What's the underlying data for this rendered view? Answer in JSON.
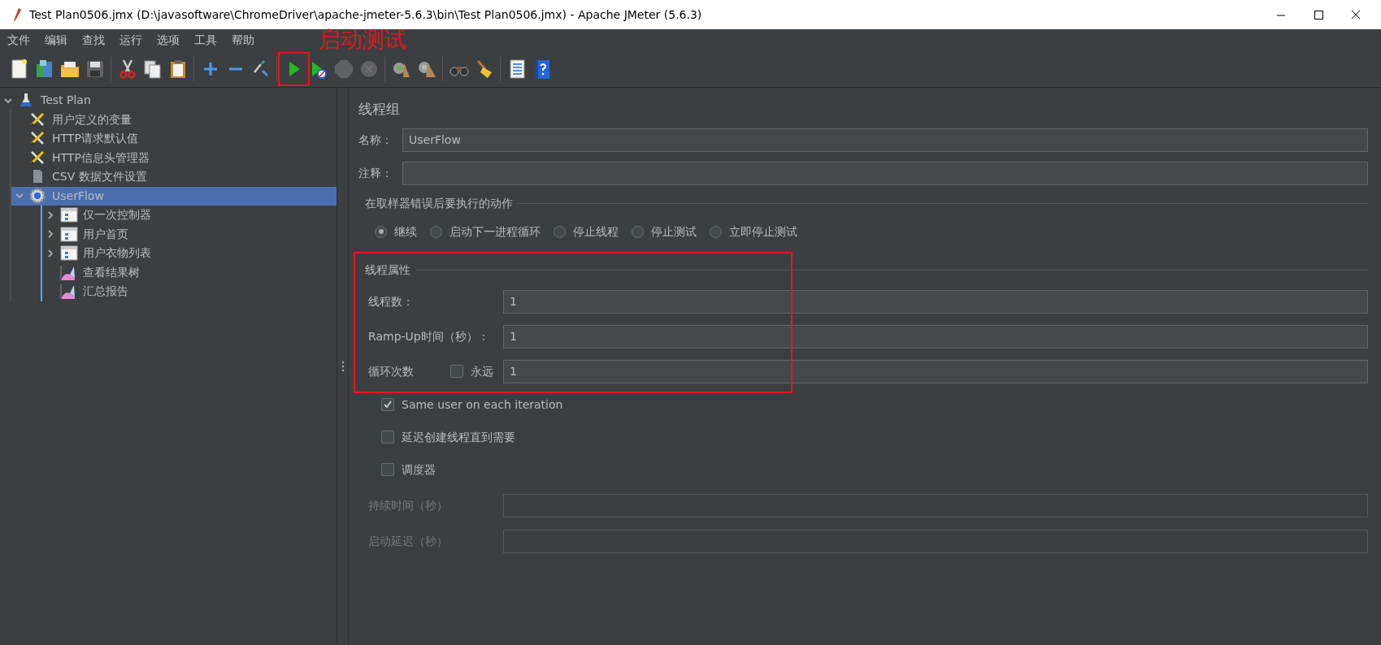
{
  "window": {
    "title": "Test Plan0506.jmx (D:\\javasoftware\\ChromeDriver\\apache-jmeter-5.6.3\\bin\\Test Plan0506.jmx) - Apache JMeter (5.6.3)"
  },
  "menu": [
    "文件",
    "编辑",
    "查找",
    "运行",
    "选项",
    "工具",
    "帮助"
  ],
  "annotation": {
    "text": "启动测试"
  },
  "toolbar": [
    {
      "kind": "new"
    },
    {
      "kind": "templates"
    },
    {
      "kind": "open"
    },
    {
      "kind": "save"
    },
    {
      "kind": "separator"
    },
    {
      "kind": "cut"
    },
    {
      "kind": "copy"
    },
    {
      "kind": "paste"
    },
    {
      "kind": "separator"
    },
    {
      "kind": "expand"
    },
    {
      "kind": "collapse"
    },
    {
      "kind": "toggle"
    },
    {
      "kind": "separator"
    },
    {
      "kind": "start",
      "highlighted": true
    },
    {
      "kind": "start-no-timers"
    },
    {
      "kind": "stop",
      "disabled": true
    },
    {
      "kind": "shutdown",
      "disabled": true
    },
    {
      "kind": "separator"
    },
    {
      "kind": "clear"
    },
    {
      "kind": "clear-all"
    },
    {
      "kind": "separator"
    },
    {
      "kind": "search"
    },
    {
      "kind": "reset-search"
    },
    {
      "kind": "separator"
    },
    {
      "kind": "functions"
    },
    {
      "kind": "help"
    }
  ],
  "tree": [
    {
      "label": "Test Plan",
      "kind": "plan",
      "expanded": true,
      "selected": false,
      "children": [
        {
          "label": "用户定义的变量",
          "kind": "config",
          "selected": false
        },
        {
          "label": "HTTP请求默认值",
          "kind": "config",
          "selected": false
        },
        {
          "label": "HTTP信息头管理器",
          "kind": "config",
          "selected": false
        },
        {
          "label": "CSV 数据文件设置",
          "kind": "csv",
          "selected": false
        },
        {
          "label": "UserFlow",
          "kind": "threadgroup",
          "expanded": true,
          "selected": true,
          "children": [
            {
              "label": "仅一次控制器",
              "kind": "controller",
              "expanded": false,
              "selected": false
            },
            {
              "label": "用户首页",
              "kind": "controller",
              "expanded": false,
              "selected": false
            },
            {
              "label": "用户衣物列表",
              "kind": "controller",
              "expanded": false,
              "selected": false
            },
            {
              "label": "查看结果树",
              "kind": "listener",
              "selected": false
            },
            {
              "label": "汇总报告",
              "kind": "listener",
              "selected": false
            }
          ]
        }
      ]
    }
  ],
  "panel": {
    "title": "线程组",
    "fields": [
      {
        "label": "名称：",
        "value": "UserFlow"
      },
      {
        "label": "注释："
      }
    ],
    "on_error": {
      "title": "在取样器错误后要执行的动作",
      "options": [
        {
          "label": "继续",
          "selected": true
        },
        {
          "label": "启动下一进程循环",
          "selected": false
        },
        {
          "label": "停止线程",
          "selected": false
        },
        {
          "label": "停止测试",
          "selected": false
        },
        {
          "label": "立即停止测试",
          "selected": false
        }
      ]
    },
    "thread_props": {
      "title": "线程属性",
      "highlighted": true,
      "rows": [
        {
          "label": "线程数：",
          "value": "1"
        },
        {
          "label": "Ramp-Up时间（秒）：",
          "value": "1"
        },
        {
          "label": "循环次数",
          "forever": {
            "label": "永远",
            "checked": false
          },
          "value": "1"
        }
      ]
    },
    "options": [
      {
        "label": "Same user on each iteration",
        "checked": true
      },
      {
        "label": "延迟创建线程直到需要",
        "checked": false
      },
      {
        "label": "调度器",
        "checked": false
      }
    ],
    "scheduler": [
      {
        "label": "持续时间（秒）",
        "disabled": true
      },
      {
        "label": "启动延迟（秒）",
        "disabled": true
      }
    ]
  }
}
